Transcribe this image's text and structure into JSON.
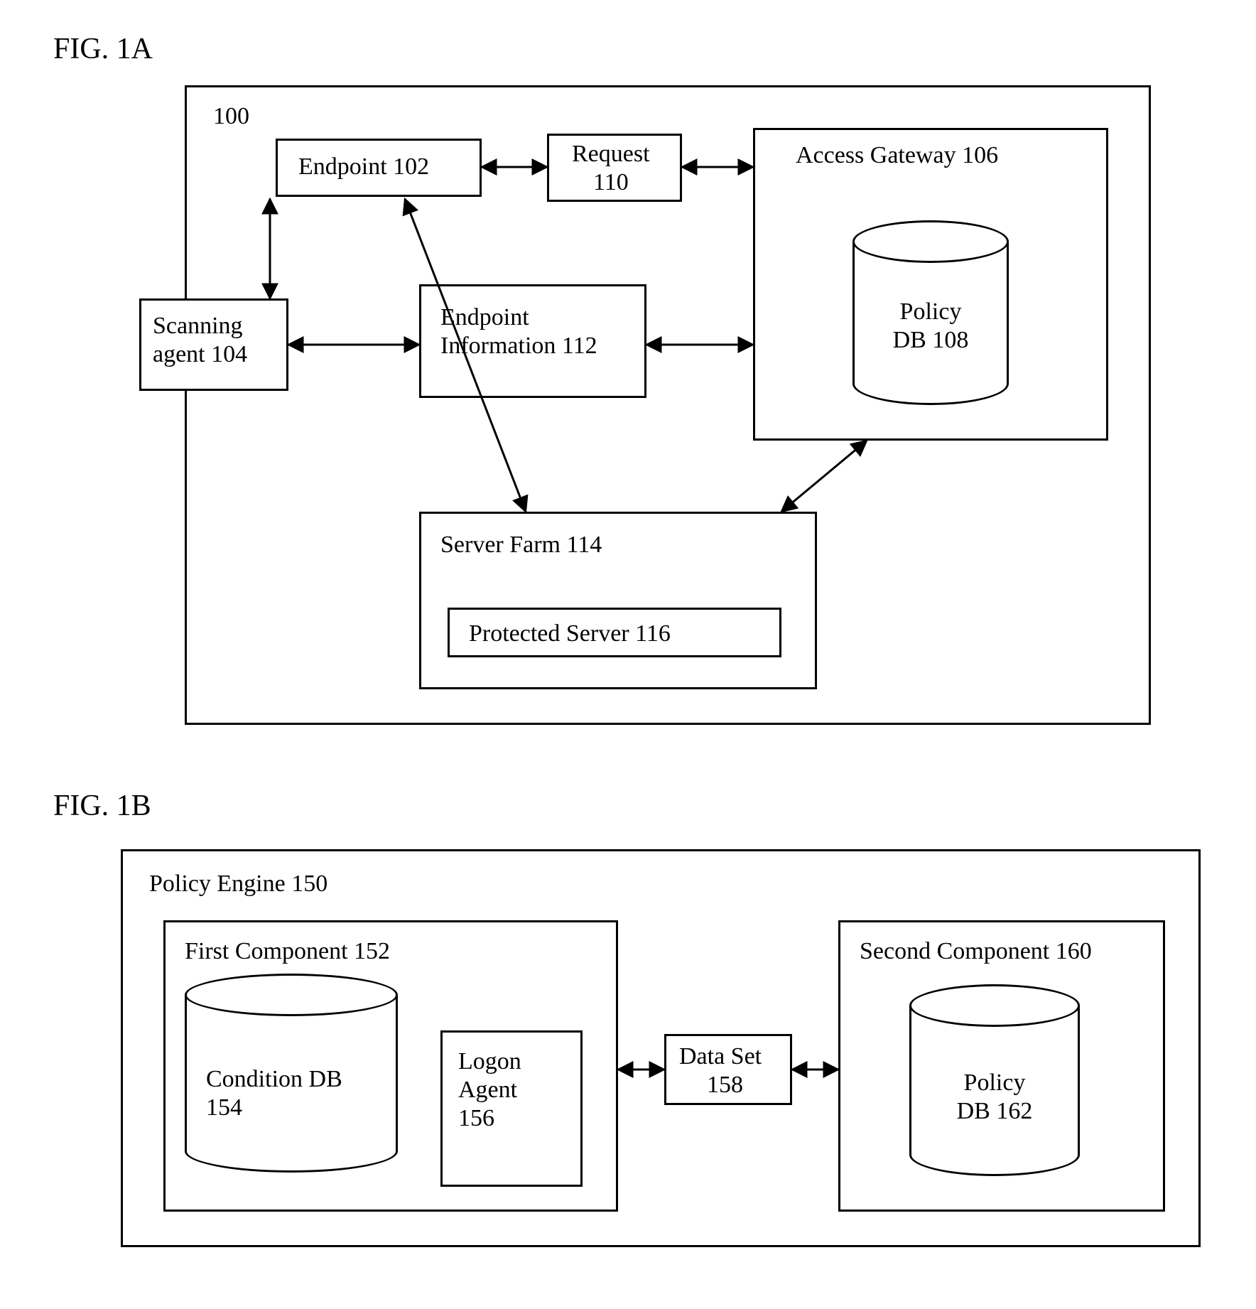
{
  "fig1a": {
    "title": "FIG. 1A",
    "system_label": "100",
    "endpoint": "Endpoint 102",
    "request_l1": "Request",
    "request_l2": "110",
    "gateway": "Access Gateway 106",
    "policy_db_l1": "Policy",
    "policy_db_l2": "DB 108",
    "scanning_l1": "Scanning",
    "scanning_l2": "agent 104",
    "endpoint_info_l1": "Endpoint",
    "endpoint_info_l2": "Information 112",
    "server_farm": "Server Farm 114",
    "protected_server": "Protected Server 116"
  },
  "fig1b": {
    "title": "FIG. 1B",
    "engine": "Policy Engine 150",
    "first_comp": "First Component 152",
    "condition_db_l1": "Condition DB",
    "condition_db_l2": "154",
    "logon_l1": "Logon",
    "logon_l2": "Agent",
    "logon_l3": "156",
    "dataset_l1": "Data Set",
    "dataset_l2": "158",
    "second_comp": "Second Component 160",
    "policy_db_l1": "Policy",
    "policy_db_l2": "DB 162"
  }
}
